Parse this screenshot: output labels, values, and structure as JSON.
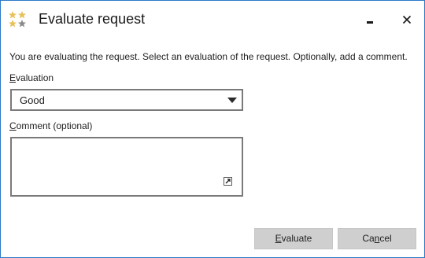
{
  "window": {
    "title": "Evaluate request",
    "icon": "stars-rating-icon",
    "accent_color": "#2b79c8"
  },
  "dialog": {
    "description": "You are evaluating the request. Select an evaluation of the request. Optionally, add a comment.",
    "evaluation": {
      "label_mnemonic": "E",
      "label_rest": "valuation",
      "selected": "Good"
    },
    "comment": {
      "label_mnemonic": "C",
      "label_rest": "omment (optional)",
      "value": ""
    }
  },
  "buttons": {
    "evaluate": {
      "mnemonic": "E",
      "rest": "valuate"
    },
    "cancel": {
      "prefix": "Ca",
      "mnemonic": "n",
      "rest": "cel"
    }
  },
  "colors": {
    "star_gold": "#e8c15a",
    "star_gray": "#8a8a8a",
    "button_bg": "#cfcfcf",
    "input_border": "#7a7a7a"
  }
}
